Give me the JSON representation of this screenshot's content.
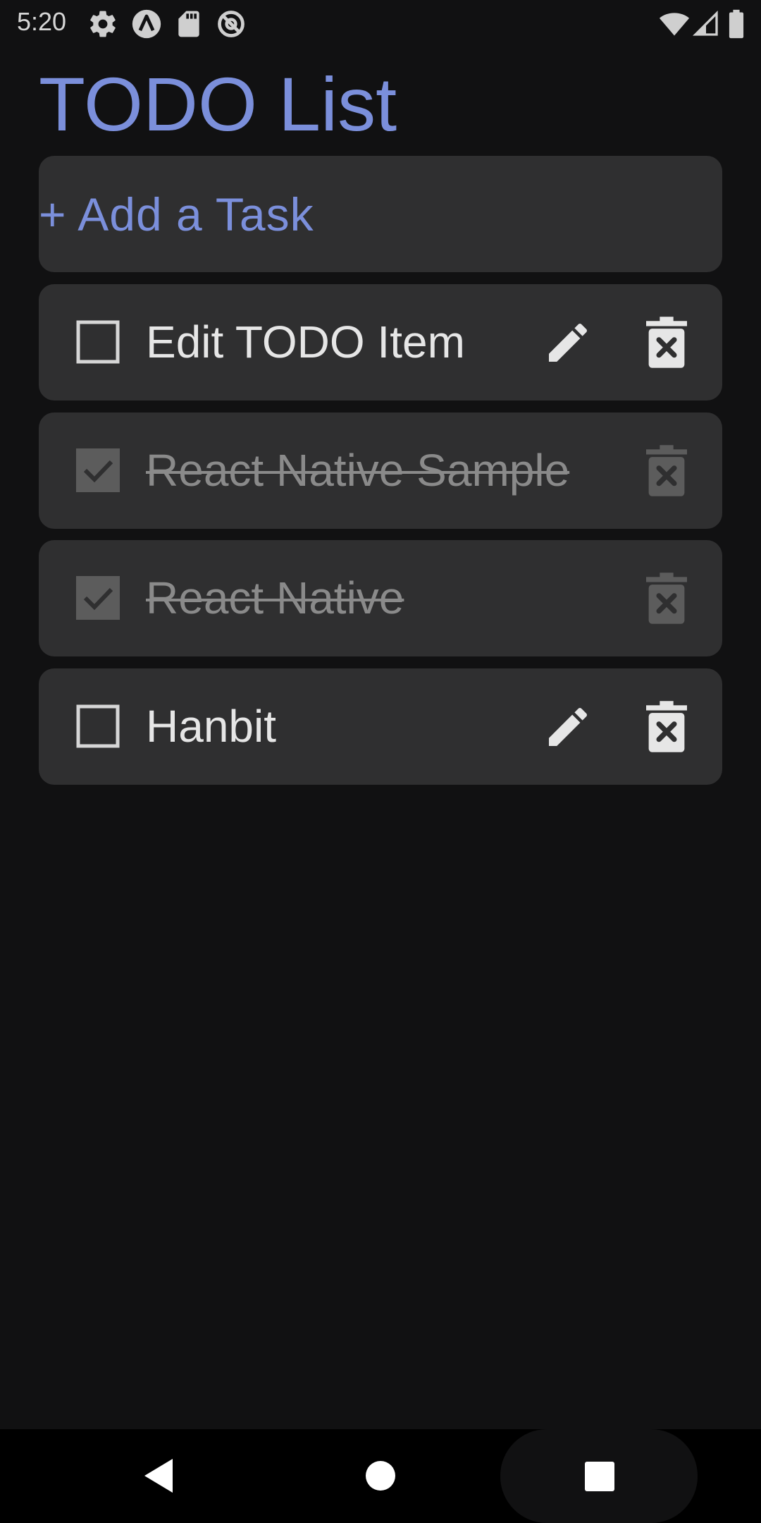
{
  "status_bar": {
    "time": "5:20",
    "left_icons": [
      "settings-icon",
      "expo-icon",
      "sd-card-icon",
      "sync-disabled-icon"
    ],
    "right_icons": [
      "wifi-icon",
      "cell-signal-icon",
      "battery-icon"
    ]
  },
  "app": {
    "title": "TODO List",
    "add_task_label": "+ Add a Task",
    "accent_color": "#7b8fdb"
  },
  "todos": [
    {
      "text": "Edit TODO Item",
      "completed": false,
      "editable": true
    },
    {
      "text": "React Native Sample",
      "completed": true,
      "editable": false
    },
    {
      "text": "React Native",
      "completed": true,
      "editable": false
    },
    {
      "text": "Hanbit",
      "completed": false,
      "editable": true
    }
  ],
  "nav_bar": {
    "buttons": [
      "back-icon",
      "home-icon",
      "recents-icon"
    ]
  }
}
